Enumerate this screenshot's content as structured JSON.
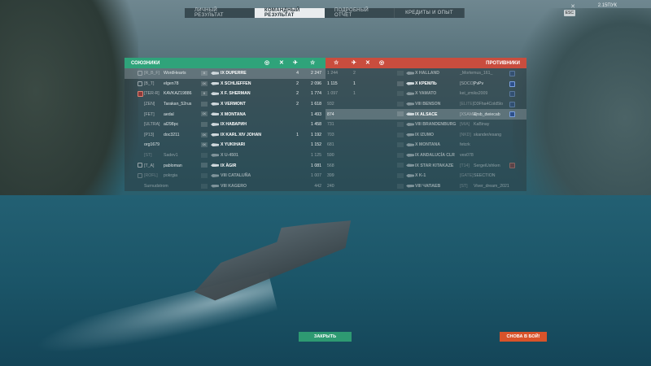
{
  "top": {
    "tabs": [
      "ЛИЧНЫЙ РЕЗУЛЬТАТ",
      "КОМАНДНЫЙ РЕЗУЛЬТАТ",
      "ПОДРОБНЫЙ ОТЧЁТ",
      "КРЕДИТЫ И ОПЫТ"
    ],
    "active_tab": 1,
    "version": "2.15ПУК",
    "esc": "ESC"
  },
  "allies": {
    "title": "СОЮЗНИКИ",
    "rows": [
      {
        "clan": "[R_B_F]",
        "player": "WordHearts",
        "tier": "X",
        "ship": "IX DUPERRE",
        "c1": "4",
        "c2": "",
        "xp": "2 247",
        "highlight": true,
        "badge": "rank"
      },
      {
        "clan": "[B_T]",
        "player": "elgen78",
        "tier": "IX",
        "ship": "X SCHLIEFFEN",
        "c1": "2",
        "c2": "",
        "xp": "2 096",
        "badge": "rank"
      },
      {
        "clan": "[TER-R]",
        "player": "KAVKAZ19886",
        "tier": "X",
        "ship": "X F. SHERMAN",
        "c1": "2",
        "c2": "",
        "xp": "1 774",
        "badge": "red"
      },
      {
        "clan": "[ZEN]",
        "player": "Tarakan_52rus",
        "tier": "",
        "ship": "X VERMONT",
        "c1": "2",
        "c2": "",
        "xp": "1 618"
      },
      {
        "clan": "[FET]",
        "player": "aedal",
        "tier": "IX",
        "ship": "X MONTANA",
        "c1": "",
        "c2": "",
        "xp": "1 493"
      },
      {
        "clan": "[ULTRA]",
        "player": "al298pc",
        "tier": "",
        "ship": "IX НАВАРИН",
        "c1": "",
        "c2": "",
        "xp": "1 458"
      },
      {
        "clan": "[P13]",
        "player": "doc3211",
        "tier": "IX",
        "ship": "IX KARL XIV JOHAN",
        "c1": "1",
        "c2": "",
        "xp": "1 192"
      },
      {
        "clan": "",
        "player": "org1679",
        "tier": "IX",
        "ship": "X YUKIHARI",
        "c1": "",
        "c2": "",
        "xp": "1 152"
      },
      {
        "clan": "[ST]",
        "player": "Sadev1",
        "tier": "",
        "ship": "X U-4501",
        "c1": "",
        "c2": "",
        "xp": "1 125",
        "dead": true
      },
      {
        "clan": "[T_A]",
        "player": "pabloman",
        "tier": "",
        "ship": "IX ÄGIR",
        "c1": "",
        "c2": "",
        "xp": "1 081",
        "badge": "rank"
      },
      {
        "clan": "[ROFL]",
        "player": "pokrgia",
        "tier": "",
        "ship": "VIII CATALUÑA",
        "c1": "",
        "c2": "",
        "xp": "1 007",
        "dead": true,
        "badge": "rank"
      },
      {
        "clan": "",
        "player": "Surnudstrom",
        "tier": "",
        "ship": "VIII KAGERO",
        "c1": "",
        "c2": "",
        "xp": "442",
        "dead": true
      }
    ]
  },
  "enemies": {
    "title": "ПРОТИВНИКИ",
    "rows": [
      {
        "xp": "1 244",
        "c1": "2",
        "ship": "X HALLAND",
        "clan": "",
        "player": "_Mortemus_161_",
        "badge": "blue",
        "dead": true
      },
      {
        "xp": "1 115",
        "c1": "1",
        "ship": "X КРЕМЛЬ",
        "clan": "[SOCO]",
        "player": "PvPv",
        "badge": "blue"
      },
      {
        "xp": "1 097",
        "c1": "1",
        "ship": "X YAMATO",
        "clan": "",
        "player": "kei_zmiks2009",
        "badge": "blue",
        "dead": true
      },
      {
        "xp": "932",
        "c1": "",
        "ship": "VIII BENSON",
        "clan": "[ELITE]",
        "player": "D3Fha4Cold5lo",
        "badge": "blue",
        "dead": true
      },
      {
        "xp": "874",
        "c1": "",
        "ship": "IX ALSACE",
        "clan": "[XSAME]",
        "player": "&rsb_dwiecab",
        "badge": "blue",
        "highlight": true
      },
      {
        "xp": "731",
        "c1": "",
        "ship": "VIII BRANDENBURG",
        "clan": "[MIA]",
        "player": "KaBinay",
        "dead": true
      },
      {
        "xp": "703",
        "c1": "",
        "ship": "IX IZUMO",
        "clan": "[NKD]",
        "player": "skander/esang",
        "dead": true
      },
      {
        "xp": "681",
        "c1": "",
        "ship": "X MONTANA",
        "clan": "",
        "player": "fetcrk",
        "dead": true
      },
      {
        "xp": "590",
        "c1": "",
        "ship": "IX ANDALUCÍA CLR",
        "clan": "",
        "player": "ves078",
        "dead": true
      },
      {
        "xp": "568",
        "c1": "",
        "ship": "IX STAR KITAKAZE",
        "clan": "[T14]",
        "player": "SergeiUshken",
        "badge": "red",
        "dead": true
      },
      {
        "xp": "399",
        "c1": "",
        "ship": "X K-1",
        "clan": "[GATE]",
        "player": "SEECTION",
        "dead": true
      },
      {
        "xp": "240",
        "c1": "",
        "ship": "VIII ЧАПАЕВ",
        "clan": "[ST]",
        "player": "Viver_dream_2021",
        "dead": true
      }
    ]
  },
  "buttons": {
    "close": "ЗАКРЫТЬ",
    "again": "СНОВА В БОЙ!"
  }
}
